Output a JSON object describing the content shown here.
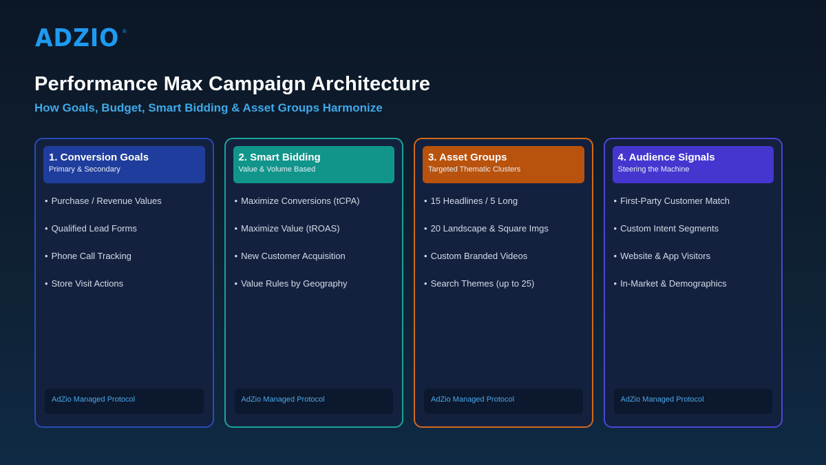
{
  "brand": {
    "logo_text": "ADZIO",
    "registered": "®"
  },
  "header": {
    "title": "Performance Max Campaign Architecture",
    "subtitle": "How Goals, Budget, Smart Bidding & Asset Groups Harmonize"
  },
  "colors": {
    "goals": "#1f3d9c",
    "bidding": "#11958a",
    "assets": "#b9520c",
    "audience": "#4436cf",
    "goals_border": "#2a4bb5",
    "bidding_border": "#1aa697",
    "assets_border": "#d36a1c",
    "audience_border": "#4e44d8"
  },
  "columns": [
    {
      "title": "1. Conversion Goals",
      "subtitle": "Primary & Secondary",
      "items": [
        "Purchase / Revenue Values",
        "Qualified Lead Forms",
        "Phone Call Tracking",
        "Store Visit Actions"
      ],
      "footer": "AdZio Managed Protocol"
    },
    {
      "title": "2. Smart Bidding",
      "subtitle": "Value & Volume Based",
      "items": [
        "Maximize Conversions (tCPA)",
        "Maximize Value (tROAS)",
        "New Customer Acquisition",
        "Value Rules by Geography"
      ],
      "footer": "AdZio Managed Protocol"
    },
    {
      "title": "3. Asset Groups",
      "subtitle": "Targeted Thematic Clusters",
      "items": [
        "15 Headlines / 5 Long",
        "20 Landscape & Square Imgs",
        "Custom Branded Videos",
        "Search Themes (up to 25)"
      ],
      "footer": "AdZio Managed Protocol"
    },
    {
      "title": "4. Audience Signals",
      "subtitle": "Steering the Machine",
      "items": [
        "First-Party Customer Match",
        "Custom Intent Segments",
        "Website & App Visitors",
        "In-Market & Demographics"
      ],
      "footer": "AdZio Managed Protocol"
    }
  ]
}
